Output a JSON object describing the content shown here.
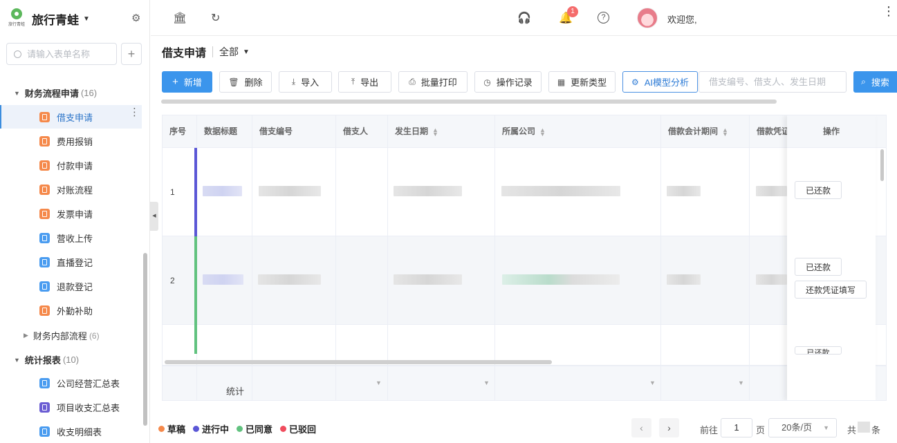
{
  "app": {
    "name": "旅行青蛙",
    "logo_text": "旅行青蛙"
  },
  "sidebar": {
    "search_placeholder": "请输入表单名称",
    "group1": {
      "label": "财务流程申请",
      "count": "(16)"
    },
    "items1": [
      {
        "label": "借支申请",
        "icon": "form-icon",
        "color": "orange"
      },
      {
        "label": "费用报销",
        "icon": "form-icon",
        "color": "orange"
      },
      {
        "label": "付款申请",
        "icon": "form-icon",
        "color": "orange"
      },
      {
        "label": "对账流程",
        "icon": "form-icon",
        "color": "orange"
      },
      {
        "label": "发票申请",
        "icon": "form-icon",
        "color": "orange"
      },
      {
        "label": "营收上传",
        "icon": "form-icon",
        "color": "blue"
      },
      {
        "label": "直播登记",
        "icon": "form-icon",
        "color": "blue"
      },
      {
        "label": "退款登记",
        "icon": "form-icon",
        "color": "blue"
      },
      {
        "label": "外勤补助",
        "icon": "form-icon",
        "color": "orange"
      }
    ],
    "group1b": {
      "label": "财务内部流程",
      "count": "(6)"
    },
    "group2": {
      "label": "统计报表",
      "count": "(10)"
    },
    "items2": [
      {
        "label": "公司经营汇总表",
        "icon": "form-icon",
        "color": "blue"
      },
      {
        "label": "项目收支汇总表",
        "icon": "form-icon",
        "color": "purple"
      },
      {
        "label": "收支明细表",
        "icon": "form-icon",
        "color": "blue"
      }
    ]
  },
  "header": {
    "welcome": "欢迎您,",
    "notification_count": "1"
  },
  "page": {
    "title": "借支申请",
    "filter": "全部"
  },
  "toolbar": {
    "new": "新增",
    "delete": "删除",
    "import": "导入",
    "export": "导出",
    "batch_print": "批量打印",
    "op_log": "操作记录",
    "update_type": "更新类型",
    "ai": "AI模型分析",
    "search_placeholder": "借支编号、借支人、发生日期",
    "search": "搜索"
  },
  "table": {
    "columns": [
      "序号",
      "数据标题",
      "借支编号",
      "借支人",
      "发生日期",
      "所属公司",
      "借款会计期间",
      "借款凭证",
      "操作"
    ],
    "rows": [
      {
        "index": "1",
        "status_color": "#5b57d6",
        "actions": [
          "已还款"
        ]
      },
      {
        "index": "2",
        "status_color": "#61c27f",
        "actions": [
          "已还款",
          "还款凭证填写"
        ]
      },
      {
        "index": "",
        "status_color": "#61c27f",
        "actions": [
          "已还款"
        ]
      }
    ],
    "footer_label": "统计"
  },
  "legend": [
    {
      "label": "草稿",
      "color": "#f5894b"
    },
    {
      "label": "进行中",
      "color": "#5b57d6"
    },
    {
      "label": "已同意",
      "color": "#61c27f"
    },
    {
      "label": "已驳回",
      "color": "#f04c5d"
    }
  ],
  "pagination": {
    "goto": "前往",
    "page": "1",
    "page_unit": "页",
    "page_size": "20条/页",
    "total_prefix": "共",
    "total_suffix": "条"
  }
}
